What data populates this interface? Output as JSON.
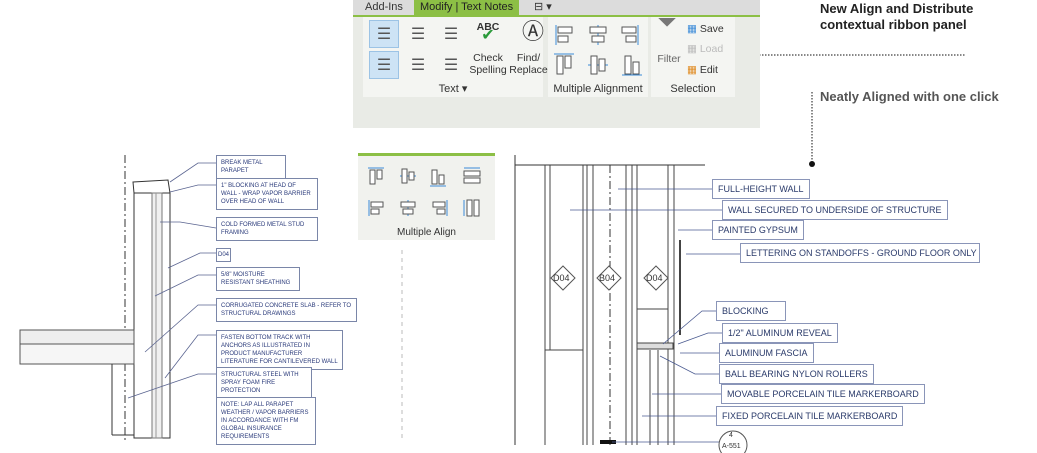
{
  "ribbon": {
    "tabs": [
      "Add-Ins",
      "Modify | Text Notes"
    ],
    "active_tab": "Modify | Text Notes",
    "panels": {
      "text": {
        "label": "Text ▾",
        "check_spelling": "Check Spelling",
        "find_replace": "Find/ Replace",
        "abc": "ABC"
      },
      "multiple_alignment": {
        "label": "Multiple Alignment"
      },
      "selection": {
        "label": "Selection",
        "filter": "Filter",
        "save": "Save",
        "load": "Load",
        "edit": "Edit"
      }
    },
    "accent": "#8cbf45"
  },
  "annotations": {
    "title": "New Align and Distribute contextual ribbon panel",
    "subtitle": "Neatly Aligned with one click"
  },
  "multiple_align_panel": {
    "label": "Multiple Align"
  },
  "left_drawing": {
    "labels": [
      "BREAK METAL PARAPET",
      "1\" BLOCKING AT HEAD OF WALL - WRAP VAPOR BARRIER OVER HEAD OF WALL",
      "COLD FORMED METAL STUD FRAMING",
      "D04",
      "5/8\" MOISTURE RESISTANT SHEATHING",
      "CORRUGATED CONCRETE SLAB - REFER TO STRUCTURAL DRAWINGS",
      "FASTEN BOTTOM TRACK WITH ANCHORS AS ILLUSTRATED IN PRODUCT MANUFACTURER LITERATURE FOR CANTILEVERED WALL",
      "STRUCTURAL STEEL WITH SPRAY FOAM FIRE PROTECTION",
      "NOTE: LAP ALL PARAPET WEATHER / VAPOR BARRIERS IN ACCORDANCE WITH FM GLOBAL INSURANCE REQUIREMENTS"
    ]
  },
  "right_drawing": {
    "tags": [
      "D04",
      "B04",
      "D04"
    ],
    "labels": [
      "FULL-HEIGHT WALL",
      "WALL SECURED TO UNDERSIDE OF STRUCTURE",
      "PAINTED GYPSUM",
      "LETTERING ON STANDOFFS - GROUND FLOOR ONLY",
      "BLOCKING",
      "1/2\" ALUMINUM REVEAL",
      "ALUMINUM FASCIA",
      "BALL BEARING NYLON ROLLERS",
      "MOVABLE PORCELAIN TILE MARKERBOARD",
      "FIXED PORCELAIN TILE MARKERBOARD"
    ],
    "section_mark": {
      "number": "4",
      "sheet": "A-551"
    }
  }
}
